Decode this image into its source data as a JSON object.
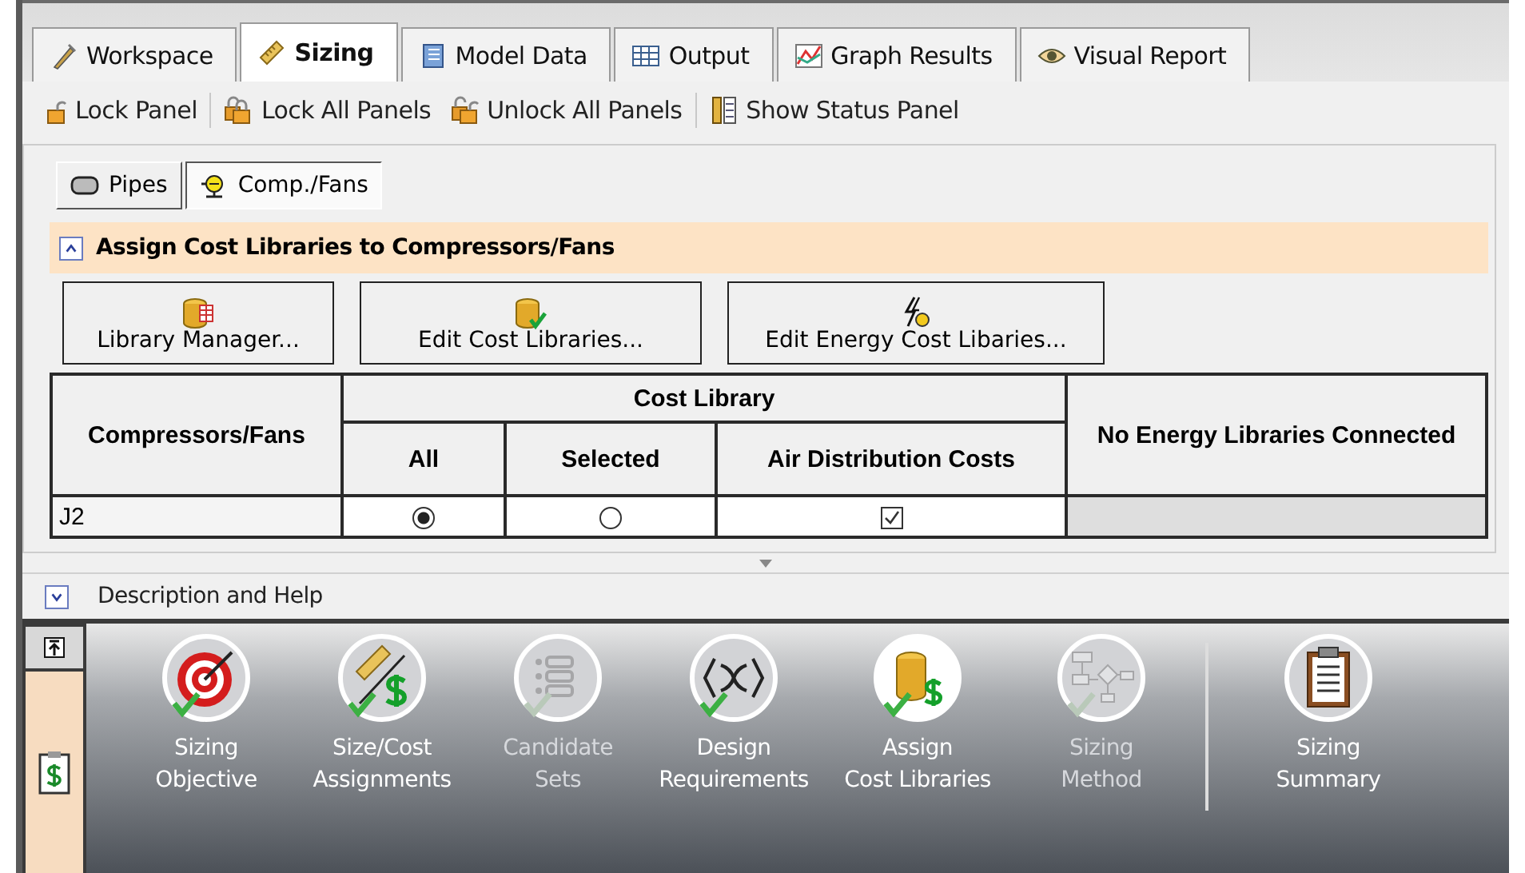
{
  "tabs": [
    {
      "label": "Workspace",
      "selected": false
    },
    {
      "label": "Sizing",
      "selected": true
    },
    {
      "label": "Model Data",
      "selected": false
    },
    {
      "label": "Output",
      "selected": false
    },
    {
      "label": "Graph Results",
      "selected": false
    },
    {
      "label": "Visual Report",
      "selected": false
    }
  ],
  "toolbar": [
    "Lock Panel",
    "Lock All Panels",
    "Unlock All Panels",
    "Show Status Panel"
  ],
  "subtabs": [
    {
      "label": "Pipes",
      "selected": false
    },
    {
      "label": "Comp./Fans",
      "selected": true
    }
  ],
  "section": {
    "title": "Assign Cost Libraries to Compressors/Fans",
    "expanded": true
  },
  "library_buttons": [
    "Library Manager...",
    "Edit Cost Libraries...",
    "Edit Energy Cost Libaries..."
  ],
  "table": {
    "name_header": "Compressors/Fans",
    "group_header": "Cost Library",
    "columns": [
      "All",
      "Selected",
      "Air Distribution Costs"
    ],
    "energy_header": "No Energy Libraries Connected",
    "rows": [
      {
        "name": "J2",
        "all": {
          "selected": true
        },
        "selected": {
          "selected": false
        },
        "library": {
          "checked": true
        }
      }
    ]
  },
  "help": {
    "title": "Description and Help",
    "expanded": false
  },
  "steps": [
    {
      "lines": [
        "Sizing",
        "Objective"
      ],
      "completed": true,
      "disabled": false,
      "selected": false
    },
    {
      "lines": [
        "Size/Cost",
        "Assignments"
      ],
      "completed": true,
      "disabled": false,
      "selected": false
    },
    {
      "lines": [
        "Candidate",
        "Sets"
      ],
      "completed": true,
      "disabled": true,
      "selected": false
    },
    {
      "lines": [
        "Design",
        "Requirements"
      ],
      "completed": true,
      "disabled": false,
      "selected": false
    },
    {
      "lines": [
        "Assign",
        "Cost Libraries"
      ],
      "completed": true,
      "disabled": false,
      "selected": true
    },
    {
      "lines": [
        "Sizing",
        "Method"
      ],
      "completed": true,
      "disabled": true,
      "selected": false
    },
    {
      "lines": [
        "Sizing",
        "Summary"
      ],
      "completed": false,
      "disabled": false,
      "selected": false
    }
  ]
}
